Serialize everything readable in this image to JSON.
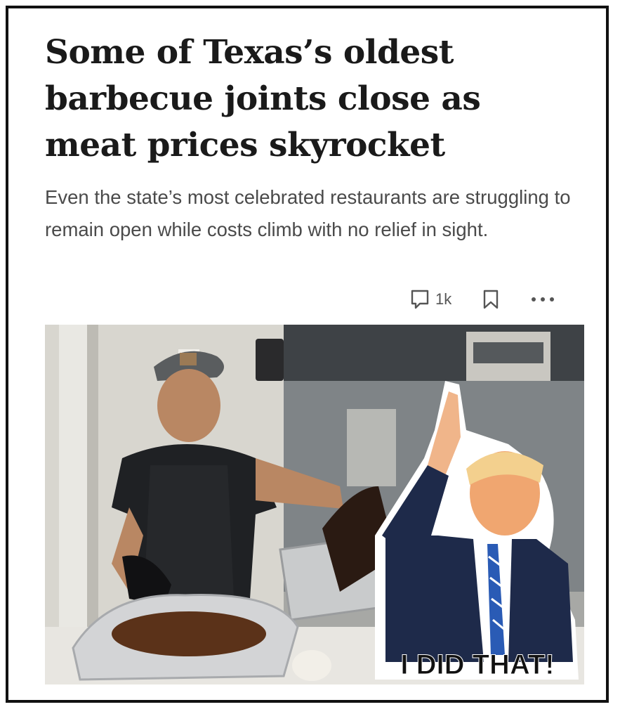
{
  "article": {
    "headline": "Some of Texas’s oldest barbecue joints close as meat prices skyrocket",
    "dek": "Even the state’s most celebrated restaurants are struggling to remain open while costs climb with no relief in sight."
  },
  "actions": {
    "comment_count": "1k",
    "comment_icon": "comment-icon",
    "bookmark_icon": "bookmark-icon",
    "more_icon": "more-dots-icon"
  },
  "photo": {
    "sticker_caption": "I DID THAT!"
  },
  "colors": {
    "headline": "#1a1a1a",
    "dek": "#4a4a4a",
    "icons": "#555555",
    "frame": "#111111"
  }
}
